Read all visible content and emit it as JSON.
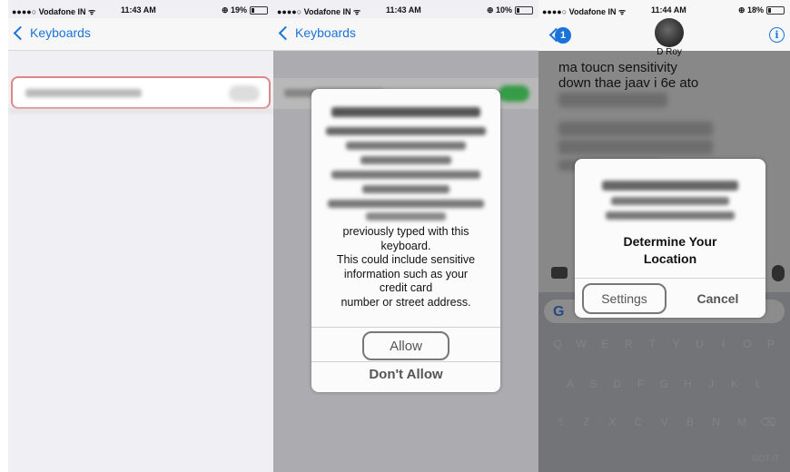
{
  "colors": {
    "accent": "#1a73d9",
    "highlight_border": "#777777"
  },
  "panel1": {
    "status": {
      "carrier": "●●●●○ Vodafone IN ᯤ",
      "time": "11:43 AM",
      "battery": "⊕ 19%"
    },
    "nav": {
      "back_label": "Keyboards"
    }
  },
  "panel2": {
    "status": {
      "carrier": "●●●●○ Vodafone IN ᯤ",
      "time": "11:43 AM",
      "battery": "⊕ 10%"
    },
    "nav": {
      "back_label": "Keyboards"
    },
    "alert": {
      "message_lines": [
        "previously typed with this",
        "keyboard.",
        "This could include sensitive",
        "information such as your",
        "credit card",
        "number or street address."
      ],
      "allow_label": "Allow",
      "dont_allow_label": "Don't Allow"
    }
  },
  "panel3": {
    "status": {
      "carrier": "●●●●○ Vodafone IN ᯤ",
      "time": "11:44 AM",
      "battery": "⊕ 18%"
    },
    "badge_count": "1",
    "contact_name": "D Roy",
    "chat_lines": [
      "ma toucn sensitivity",
      "down thae jaav i 6e ato"
    ],
    "alert": {
      "title_lines": [
        "Determine Your",
        "Location"
      ],
      "settings_label": "Settings",
      "cancel_label": "Cancel"
    },
    "keyboard": {
      "google_letter": "G",
      "row1": [
        "Q",
        "W",
        "E",
        "R",
        "T",
        "Y",
        "U",
        "I",
        "O",
        "P"
      ],
      "row2": [
        "A",
        "S",
        "D",
        "F",
        "G",
        "H",
        "J",
        "K",
        "L"
      ],
      "row3": [
        "Z",
        "X",
        "C",
        "V",
        "B",
        "N",
        "M"
      ],
      "got_it": "GOT IT"
    }
  }
}
